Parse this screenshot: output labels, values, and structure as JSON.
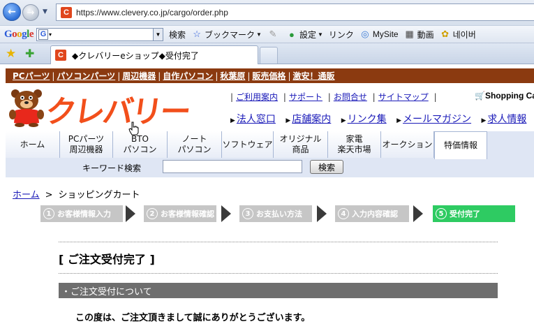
{
  "browser": {
    "url": "https://www.clevery.co.jp/cargo/order.php",
    "favicon_letter": "C",
    "google_logo": [
      "G",
      "o",
      "o",
      "g",
      "l",
      "e"
    ],
    "search_value": "",
    "toolbar": {
      "search_label": "検索",
      "bookmark_label": "ブックマーク",
      "settings_label": "設定",
      "link_label": "リンク",
      "mysite_label": "MySite",
      "video_label": "動画",
      "naver_label": "네이버"
    },
    "tab_title": "◆クレバリーeショップ◆受付完了"
  },
  "site": {
    "top_nav": [
      "PCパーツ",
      "パソコンパーツ",
      "周辺機器",
      "自作パソコン",
      "秋葉原",
      "販売価格",
      "激安！通販"
    ],
    "logo_text": "クレバリー",
    "sub_links": [
      "ご利用案内",
      "サポート",
      "お問合せ",
      "サイトマップ"
    ],
    "cart_label": "Shopping Ca",
    "info_links": [
      "法人窓口",
      "店舗案内",
      "リンク集",
      "メールマガジン",
      "求人情報"
    ],
    "nav_tabs": [
      {
        "line1": "ホーム",
        "line2": ""
      },
      {
        "line1": "PCパーツ",
        "line2": "周辺機器"
      },
      {
        "line1": "BTO",
        "line2": "パソコン"
      },
      {
        "line1": "ノート",
        "line2": "パソコン"
      },
      {
        "line1": "ソフトウェア",
        "line2": ""
      },
      {
        "line1": "オリジナル",
        "line2": "商品"
      },
      {
        "line1": "家電",
        "line2": "楽天市場"
      },
      {
        "line1": "オークション",
        "line2": ""
      },
      {
        "line1": "特価情報",
        "line2": ""
      }
    ],
    "keyword_label": "キーワード検索",
    "keyword_value": "",
    "search_button": "検索",
    "breadcrumb": {
      "home": "ホーム",
      "sep": ">",
      "current": "ショッピングカート"
    },
    "steps": [
      {
        "num": "1",
        "label": "お客様情報入力",
        "active": false
      },
      {
        "num": "2",
        "label": "お客様情報確認",
        "active": false
      },
      {
        "num": "3",
        "label": "お支払い方法",
        "active": false
      },
      {
        "num": "4",
        "label": "入力内容確認",
        "active": false
      },
      {
        "num": "5",
        "label": "受付完了",
        "active": true
      }
    ],
    "heading": "[ ご注文受付完了 ]",
    "section_title": "・ご注文受付について",
    "thanks": "この度は、ご注文頂きまして誠にありがとうございます。"
  },
  "colors": {
    "brown_nav": "#8b3a10",
    "logo_orange": "#f24f1b",
    "step_active": "#2ecb62",
    "step_inactive": "#c6c6c6",
    "section_bar": "#6e6e6e"
  }
}
